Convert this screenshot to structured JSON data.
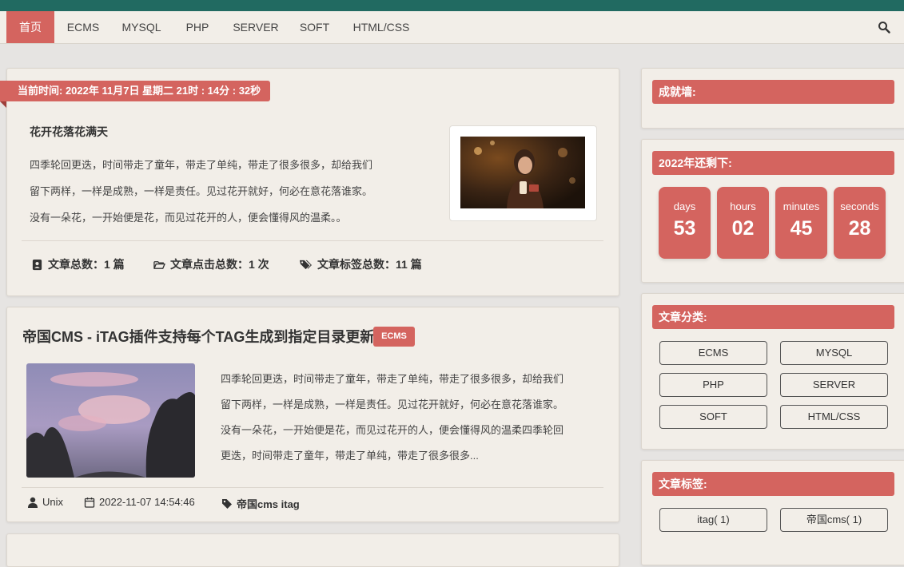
{
  "nav": {
    "items": [
      {
        "label": "首页",
        "active": true
      },
      {
        "label": "ECMS",
        "active": false
      },
      {
        "label": "MYSQL",
        "active": false
      },
      {
        "label": "PHP",
        "active": false
      },
      {
        "label": "SERVER",
        "active": false
      },
      {
        "label": "SOFT",
        "active": false
      },
      {
        "label": "HTML/CSS",
        "active": false
      }
    ],
    "search_icon": "search-icon"
  },
  "intro": {
    "current_time": "当前时间: 2022年 11月7日 星期二 21时 : 14分 : 32秒",
    "title": "花开花落花满天",
    "lines": [
      "四季轮回更迭，时间带走了童年，带走了单纯，带走了很多很多，却给我们",
      "留下两样，一样是成熟，一样是责任。见过花开就好，何必在意花落谁家。",
      "没有一朵花，一开始便是花，而见过花开的人，便会懂得风的温柔。。"
    ],
    "stats": [
      {
        "icon": "address-book-icon",
        "text": "文章总数：1 篇"
      },
      {
        "icon": "folder-open-icon",
        "text": "文章点击总数：1 次"
      },
      {
        "icon": "tags-icon",
        "text": "文章标签总数：11 篇"
      }
    ]
  },
  "post": {
    "title": "帝国CMS - iTAG插件支持每个TAG生成到指定目录更新",
    "badge": "ECMS",
    "lines": [
      "四季轮回更迭，时间带走了童年，带走了单纯，带走了很多很多，却给我们",
      "留下两样，一样是成熟，一样是责任。见过花开就好，何必在意花落谁家。",
      "没有一朵花，一开始便是花，而见过花开的人，便会懂得风的温柔四季轮回",
      "更迭，时间带走了童年，带走了单纯，带走了很多很多..."
    ],
    "meta": {
      "author": "Unix",
      "date": "2022-11-07 14:54:46",
      "tags": "帝国cms itag"
    }
  },
  "sidebar": {
    "achievements": {
      "title": "成就墙:"
    },
    "countdown": {
      "title": "2022年还剩下:",
      "units": [
        {
          "label": "days",
          "value": "53"
        },
        {
          "label": "hours",
          "value": "02"
        },
        {
          "label": "minutes",
          "value": "45"
        },
        {
          "label": "seconds",
          "value": "28"
        }
      ]
    },
    "categories": {
      "title": "文章分类:",
      "items": [
        "ECMS",
        "MYSQL",
        "PHP",
        "SERVER",
        "SOFT",
        "HTML/CSS"
      ]
    },
    "tags": {
      "title": "文章标签:",
      "items": [
        "itag( 1)",
        "帝国cms( 1)"
      ]
    }
  },
  "colors": {
    "accent": "#d4645f",
    "top_strip": "#216a61",
    "card_bg": "#f2eee8",
    "page_bg": "#e6e4e2"
  }
}
